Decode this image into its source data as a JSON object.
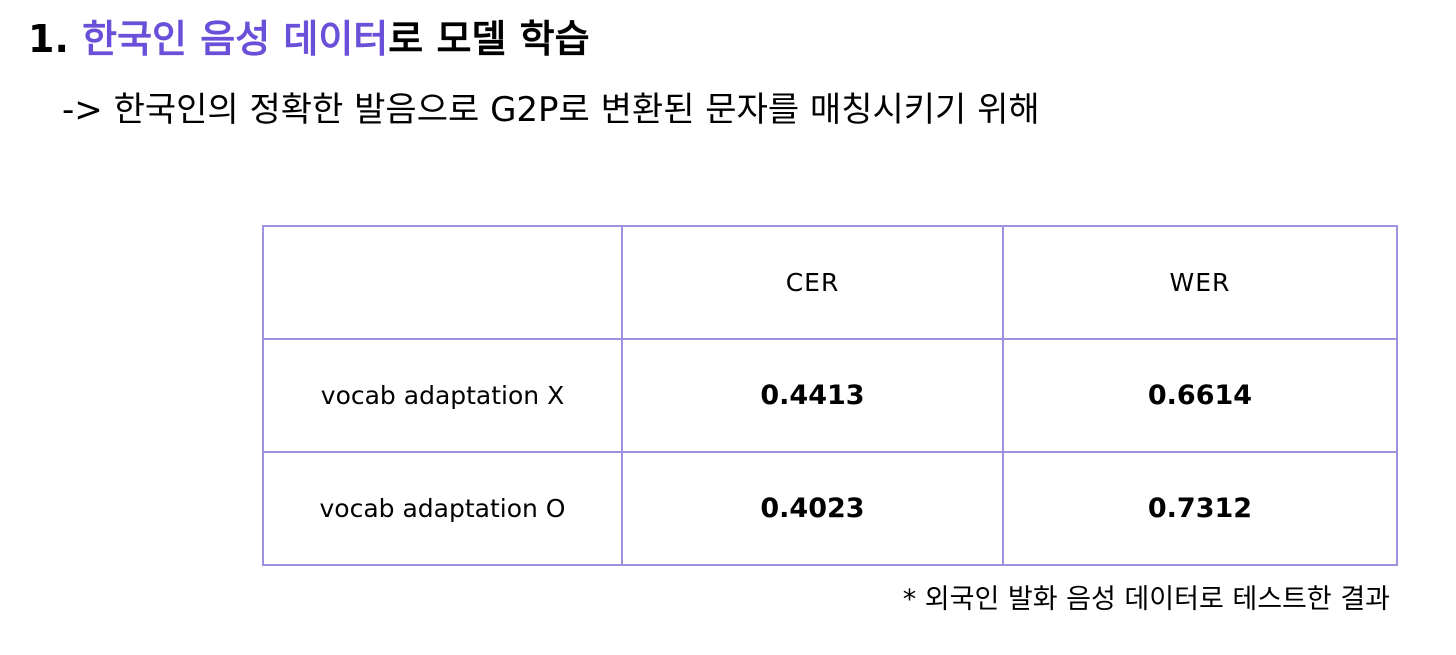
{
  "heading": {
    "number": "1.",
    "highlight": "한국인 음성 데이터",
    "rest": "로 모델 학습"
  },
  "subheading": "-> 한국인의 정확한 발음으로 G2P로 변환된 문자를 매칭시키기 위해",
  "table": {
    "columns": [
      "",
      "CER",
      "WER"
    ],
    "rows": [
      {
        "label": "vocab adaptation X",
        "cer": "0.4413",
        "wer": "0.6614"
      },
      {
        "label": "vocab adaptation O",
        "cer": "0.4023",
        "wer": "0.7312"
      }
    ]
  },
  "footnote": "* 외국인 발화 음성 데이터로 테스트한 결과",
  "colors": {
    "accent": "#6a4fd8",
    "table_border": "#a090e0"
  }
}
